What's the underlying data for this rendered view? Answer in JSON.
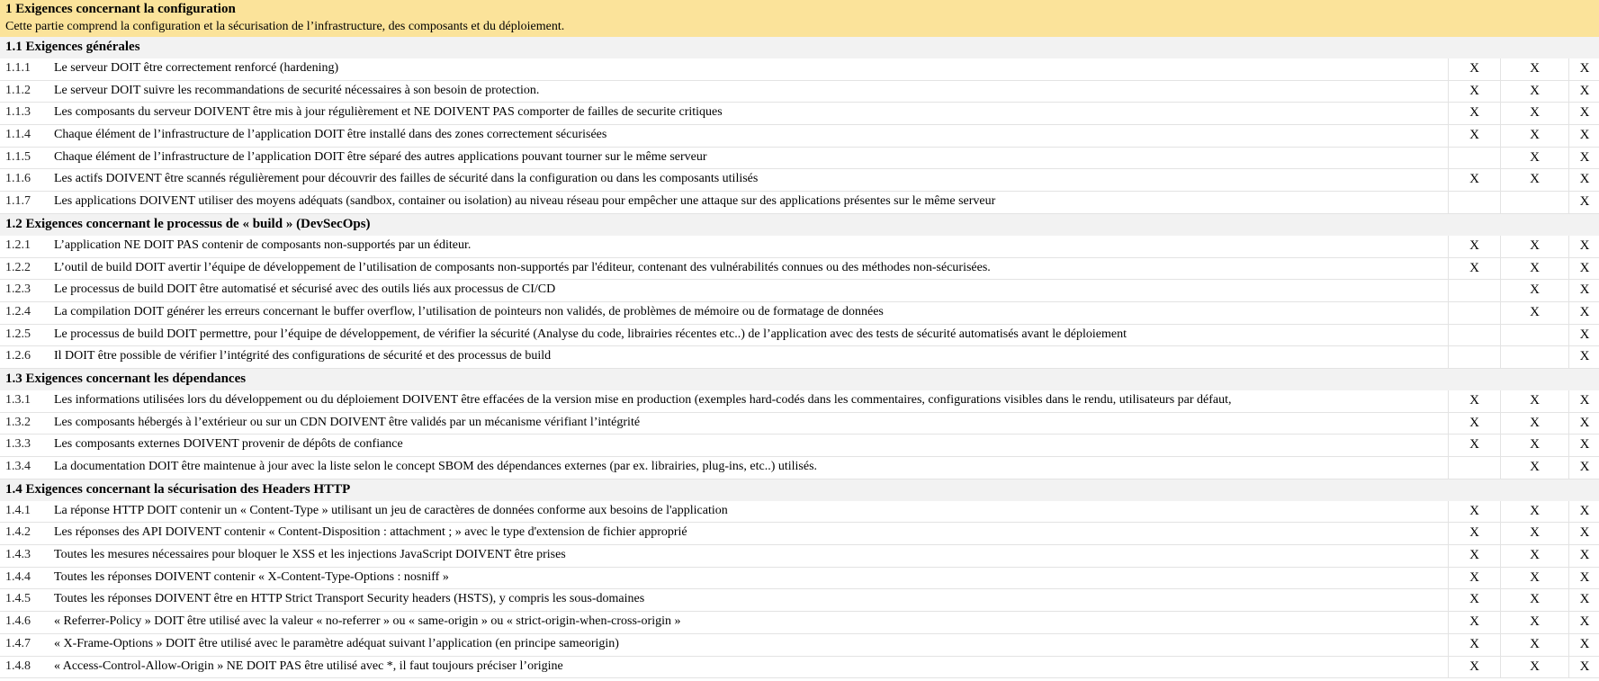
{
  "chapter": {
    "title": "1 Exigences concernant la configuration",
    "description": "Cette partie comprend la configuration et la sécurisation de l’infrastructure, des composants et du déploiement."
  },
  "check_mark": "X",
  "sections": [
    {
      "title": "1.1 Exigences générales",
      "rows": [
        {
          "num": "1.1.1",
          "text": "Le serveur DOIT être correctement renforcé (hardening)",
          "l1": true,
          "l2": true,
          "l3": true
        },
        {
          "num": "1.1.2",
          "text": "Le serveur DOIT suivre les recommandations de securité nécessaires à son besoin de protection.",
          "l1": true,
          "l2": true,
          "l3": true
        },
        {
          "num": "1.1.3",
          "text": "Les composants du serveur DOIVENT être mis à jour régulièrement et NE DOIVENT PAS comporter de failles de securite critiques",
          "l1": true,
          "l2": true,
          "l3": true
        },
        {
          "num": "1.1.4",
          "text": "Chaque élément de l’infrastructure de l’application DOIT être installé dans des zones correctement sécurisées",
          "l1": true,
          "l2": true,
          "l3": true
        },
        {
          "num": "1.1.5",
          "text": "Chaque élément de l’infrastructure de l’application DOIT être séparé des autres applications pouvant tourner sur le même serveur",
          "l1": false,
          "l2": true,
          "l3": true
        },
        {
          "num": "1.1.6",
          "text": "Les actifs DOIVENT être scannés régulièrement pour découvrir des failles de sécurité dans la configuration ou dans les composants utilisés",
          "l1": true,
          "l2": true,
          "l3": true
        },
        {
          "num": "1.1.7",
          "text": "Les applications DOIVENT utiliser des moyens adéquats (sandbox, container ou isolation) au niveau réseau pour empêcher une attaque sur des applications présentes sur le même serveur",
          "l1": false,
          "l2": false,
          "l3": true
        }
      ]
    },
    {
      "title": "1.2 Exigences concernant le processus de « build » (DevSecOps)",
      "rows": [
        {
          "num": "1.2.1",
          "text": "L’application NE DOIT PAS contenir de composants non-supportés par un éditeur.",
          "l1": true,
          "l2": true,
          "l3": true
        },
        {
          "num": "1.2.2",
          "text": "L’outil de build DOIT avertir l’équipe de développement de l’utilisation de composants non-supportés par l'éditeur, contenant des vulnérabilités connues ou des méthodes non-sécurisées.",
          "l1": true,
          "l2": true,
          "l3": true
        },
        {
          "num": "1.2.3",
          "text": "Le processus de build DOIT être automatisé et sécurisé avec des outils liés aux processus de CI/CD",
          "l1": false,
          "l2": true,
          "l3": true
        },
        {
          "num": "1.2.4",
          "text": "La compilation DOIT générer les erreurs concernant le buffer overflow, l’utilisation de pointeurs non validés, de problèmes de mémoire ou de formatage de données",
          "l1": false,
          "l2": true,
          "l3": true
        },
        {
          "num": "1.2.5",
          "text": "Le processus de build DOIT permettre, pour l’équipe de développement, de vérifier la sécurité (Analyse du code, librairies récentes etc..) de l’application avec des tests de sécurité automatisés avant le déploiement",
          "l1": false,
          "l2": false,
          "l3": true
        },
        {
          "num": "1.2.6",
          "text": "Il DOIT être possible de vérifier l’intégrité des configurations de sécurité et des processus de build",
          "l1": false,
          "l2": false,
          "l3": true
        }
      ]
    },
    {
      "title": "1.3 Exigences concernant les dépendances",
      "rows": [
        {
          "num": "1.3.1",
          "text": "Les informations utilisées lors du développement ou du déploiement DOIVENT être effacées de la version mise en production (exemples hard-codés dans les commentaires, configurations visibles dans le rendu, utilisateurs par défaut,",
          "l1": true,
          "l2": true,
          "l3": true
        },
        {
          "num": "1.3.2",
          "text": "Les composants hébergés à l’extérieur ou sur un CDN DOIVENT être validés par un mécanisme vérifiant l’intégrité",
          "l1": true,
          "l2": true,
          "l3": true
        },
        {
          "num": "1.3.3",
          "text": "Les composants externes DOIVENT provenir de dépôts de confiance",
          "l1": true,
          "l2": true,
          "l3": true
        },
        {
          "num": "1.3.4",
          "text": "La documentation DOIT être maintenue à jour avec la liste selon le concept SBOM des dépendances externes (par ex. librairies, plug-ins, etc..) utilisés.",
          "l1": false,
          "l2": true,
          "l3": true
        }
      ]
    },
    {
      "title": "1.4 Exigences concernant la sécurisation des Headers HTTP",
      "rows": [
        {
          "num": "1.4.1",
          "text": "La réponse HTTP DOIT contenir un « Content-Type » utilisant un jeu de caractères de données conforme aux besoins de l'application",
          "l1": true,
          "l2": true,
          "l3": true
        },
        {
          "num": "1.4.2",
          "text": "Les réponses des API DOIVENT contenir « Content-Disposition : attachment ; » avec le type d'extension de  fichier approprié",
          "l1": true,
          "l2": true,
          "l3": true
        },
        {
          "num": "1.4.3",
          "text": "Toutes les mesures nécessaires pour bloquer le XSS et les injections JavaScript DOIVENT être prises",
          "l1": true,
          "l2": true,
          "l3": true
        },
        {
          "num": "1.4.4",
          "text": "Toutes les réponses DOIVENT contenir « X-Content-Type-Options : nosniff »",
          "l1": true,
          "l2": true,
          "l3": true
        },
        {
          "num": "1.4.5",
          "text": "Toutes les réponses DOIVENT être en HTTP Strict Transport Security headers (HSTS), y compris les sous-domaines",
          "l1": true,
          "l2": true,
          "l3": true
        },
        {
          "num": "1.4.6",
          "text": "« Referrer-Policy » DOIT être utilisé avec la valeur « no-referrer » ou « same-origin » ou « strict-origin-when-cross-origin »",
          "l1": true,
          "l2": true,
          "l3": true
        },
        {
          "num": "1.4.7",
          "text": "« X-Frame-Options » DOIT être utilisé avec le paramètre adéquat suivant l’application (en principe sameorigin)",
          "l1": true,
          "l2": true,
          "l3": true
        },
        {
          "num": "1.4.8",
          "text": "« Access-Control-Allow-Origin » NE DOIT PAS être utilisé avec *, il faut toujours préciser l’origine",
          "l1": true,
          "l2": true,
          "l3": true
        }
      ]
    }
  ]
}
